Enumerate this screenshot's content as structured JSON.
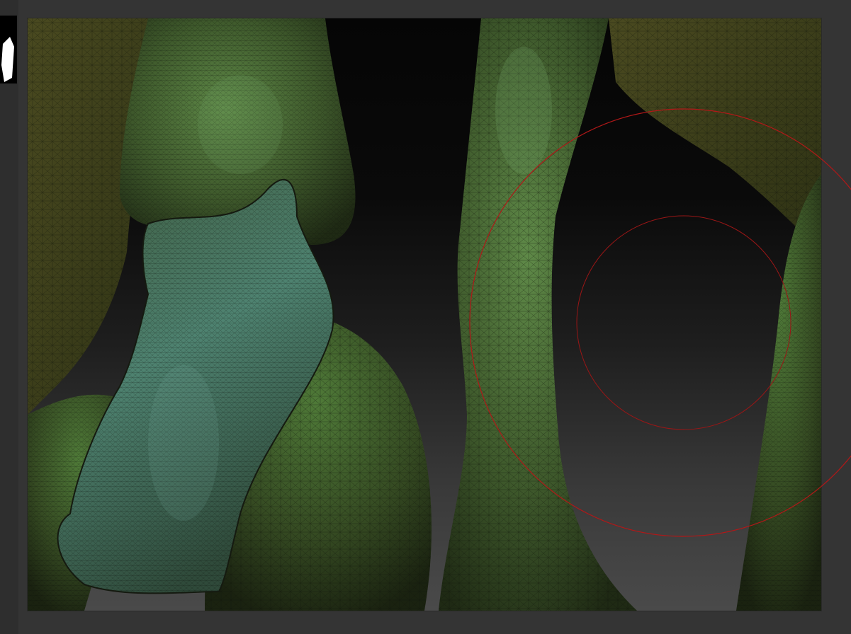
{
  "window": {
    "background_color": "#343434",
    "viewport_background_top": "#050505",
    "viewport_background_bottom": "#4a4a4a"
  },
  "left_shelf": {
    "tool_thumbnail_icon": "current-tool-thumbnail-icon"
  },
  "canvas": {
    "model": "sculpted-mesh-polyframe",
    "mesh_color": "#3f5a2c",
    "mesh_highlight": "#5c8a55",
    "wireframe_color": "#0e1208"
  },
  "brush_cursor": {
    "outer_ring_icon": "brush-draw-size-ring-icon",
    "inner_ring_icon": "brush-focal-shift-ring-icon",
    "color": "#b01818"
  }
}
